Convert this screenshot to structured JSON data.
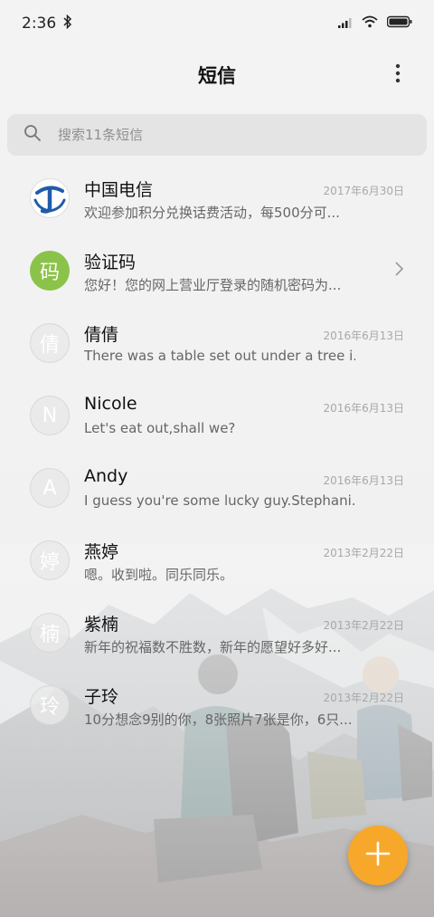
{
  "status_bar": {
    "time": "2:36"
  },
  "header": {
    "title": "短信"
  },
  "search": {
    "placeholder": "搜索11条短信"
  },
  "conversations": [
    {
      "name": "中国电信",
      "date": "2017年6月30日",
      "preview": "欢迎参加积分兑换话费活动，每500分可...",
      "avatar_text": "",
      "avatar_type": "china-telecom-logo"
    },
    {
      "name": "验证码",
      "date": "",
      "preview": "您好！您的网上营业厅登录的随机密码为...",
      "avatar_text": "码",
      "avatar_type": "green"
    },
    {
      "name": "倩倩",
      "date": "2016年6月13日",
      "preview": "There was a table set out under a tree i...",
      "avatar_text": "倩",
      "avatar_type": "grey"
    },
    {
      "name": "Nicole",
      "date": "2016年6月13日",
      "preview": "Let's eat out,shall we?",
      "avatar_text": "N",
      "avatar_type": "grey"
    },
    {
      "name": "Andy",
      "date": "2016年6月13日",
      "preview": "I guess you're some lucky guy.Stephani...",
      "avatar_text": "A",
      "avatar_type": "grey"
    },
    {
      "name": "燕婷",
      "date": "2013年2月22日",
      "preview": "嗯。收到啦。同乐同乐。",
      "avatar_text": "婷",
      "avatar_type": "grey"
    },
    {
      "name": "紫楠",
      "date": "2013年2月22日",
      "preview": "新年的祝福数不胜数，新年的愿望好多好...",
      "avatar_text": "楠",
      "avatar_type": "grey"
    },
    {
      "name": "子玲",
      "date": "2013年2月22日",
      "preview": "10分想念9别的你，8张照片7张是你，6只...",
      "avatar_text": "玲",
      "avatar_type": "grey"
    }
  ],
  "colors": {
    "fab": "#f7a82a",
    "green_avatar": "#8bc34a",
    "telecom_blue": "#1f5ca8"
  }
}
